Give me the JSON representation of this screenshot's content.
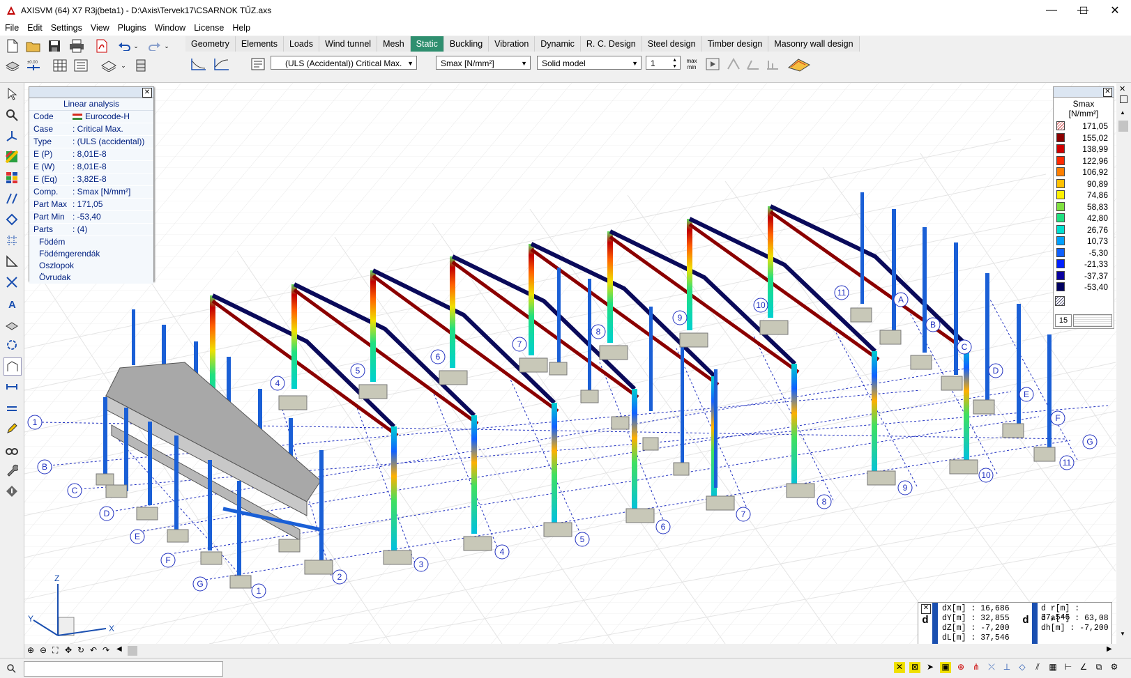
{
  "window": {
    "title": "AXISVM (64) X7 R3j(beta1) - D:\\Axis\\Tervek17\\CSARNOK TŰZ.axs",
    "minimize": "—",
    "maximize": "☐",
    "close": "✕"
  },
  "menu": [
    "File",
    "Edit",
    "Settings",
    "View",
    "Plugins",
    "Window",
    "License",
    "Help"
  ],
  "tabs": [
    "Geometry",
    "Elements",
    "Loads",
    "Wind tunnel",
    "Mesh",
    "Static",
    "Buckling",
    "Vibration",
    "Dynamic",
    "R. C. Design",
    "Steel design",
    "Timber design",
    "Masonry wall design"
  ],
  "active_tab": "Static",
  "toolbar": {
    "load_case": "(ULS (Accidental)) Critical Max.",
    "component": "Smax [N/mm²]",
    "display_mode": "Solid model",
    "counter": "1",
    "max_label": "max",
    "min_label": "min"
  },
  "info_panel": {
    "title": "Linear analysis",
    "rows": [
      {
        "k": "Code",
        "v": "Eurocode-H"
      },
      {
        "k": "Case",
        "v": ": Critical Max."
      },
      {
        "k": "Type",
        "v": ": (ULS (accidental))"
      },
      {
        "k": "E (P)",
        "v": ": 8,01E-8"
      },
      {
        "k": "E (W)",
        "v": ": 8,01E-8"
      },
      {
        "k": "E (Eq)",
        "v": ": 3,82E-8"
      },
      {
        "k": "Comp.",
        "v": ": Smax [N/mm²]"
      },
      {
        "k": "Part Max",
        "v": ": 171,05"
      },
      {
        "k": "Part Min",
        "v": ": -53,40"
      },
      {
        "k": "Parts",
        "v": ": (4)"
      }
    ],
    "parts": [
      "Födém",
      "Födémgerendák",
      "Oszlopok",
      "Övrudak"
    ]
  },
  "legend": {
    "title": "Smax",
    "unit": "[N/mm²]",
    "entries": [
      {
        "value": "171,05",
        "color": "#ffffff"
      },
      {
        "value": "155,02",
        "color": "#8b0000"
      },
      {
        "value": "138,99",
        "color": "#d00000"
      },
      {
        "value": "122,96",
        "color": "#ff2a00"
      },
      {
        "value": "106,92",
        "color": "#ff7f00"
      },
      {
        "value": "90,89",
        "color": "#ffc000"
      },
      {
        "value": "74,86",
        "color": "#fff000"
      },
      {
        "value": "58,83",
        "color": "#80e040"
      },
      {
        "value": "42,80",
        "color": "#20e080"
      },
      {
        "value": "26,76",
        "color": "#00e0d0"
      },
      {
        "value": "10,73",
        "color": "#00a0ff"
      },
      {
        "value": "-5,30",
        "color": "#1060ff"
      },
      {
        "value": "-21,33",
        "color": "#0020ff"
      },
      {
        "value": "-37,37",
        "color": "#0a00a0"
      },
      {
        "value": "-53,40",
        "color": "#000060"
      }
    ],
    "steps": "15"
  },
  "coords": {
    "dX": "dX[m] : 16,686",
    "dY": "dY[m] : 32,855",
    "dZ": "dZ[m] : -7,200",
    "dL": "dL[m] : 37,546",
    "dr": "d r[m] : 37,546",
    "da": "d a[°] : 63,08",
    "dh": "dh[m] : -7,200"
  },
  "axes": {
    "x": "X",
    "y": "Y",
    "z": "Z"
  },
  "grid_labels": {
    "numbers": [
      "1",
      "2",
      "3",
      "4",
      "5",
      "6",
      "7",
      "8",
      "9",
      "10",
      "11"
    ],
    "letters": [
      "A",
      "B",
      "C",
      "D",
      "E",
      "F",
      "G"
    ]
  },
  "colors": {
    "active_tab": "#2f8f6f",
    "frame_dark": "#0a0a5a",
    "column_blue": "#1a5fd6",
    "grid_blue": "#2030c0"
  }
}
